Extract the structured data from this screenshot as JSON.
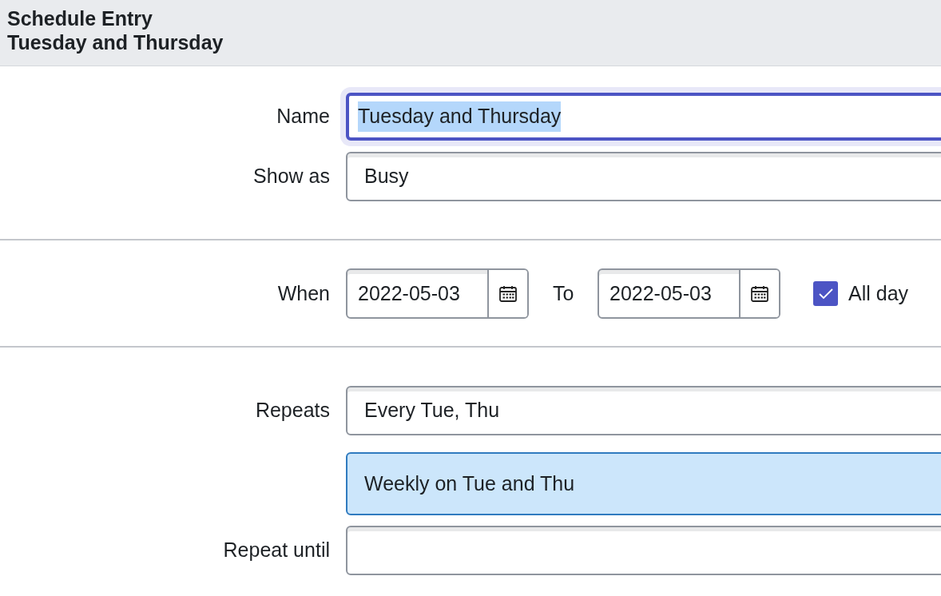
{
  "header": {
    "title": "Schedule Entry",
    "subtitle": "Tuesday and Thursday"
  },
  "name": {
    "label": "Name",
    "value": "Tuesday and Thursday",
    "focused": true,
    "text_highlighted": true
  },
  "show_as": {
    "label": "Show as",
    "value": "Busy"
  },
  "when": {
    "label": "When",
    "start": "2022-05-03",
    "to_label": "To",
    "end": "2022-05-03",
    "all_day": {
      "label": "All day",
      "checked": true
    }
  },
  "repeats": {
    "label": "Repeats",
    "value": "Every Tue, Thu",
    "summary": "Weekly on Tue and Thu"
  },
  "repeat_until": {
    "label": "Repeat until"
  }
}
